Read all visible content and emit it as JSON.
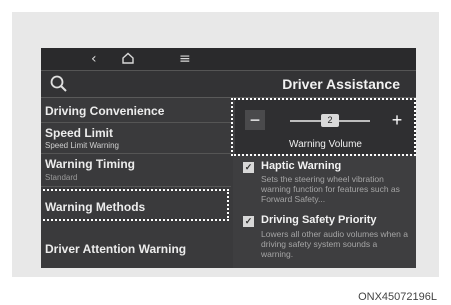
{
  "nav": {
    "back_icon": "chevron-left-icon",
    "home_icon": "home-icon",
    "menu_icon": "menu-icon"
  },
  "header": {
    "search_icon": "search-icon",
    "title": "Driver Assistance"
  },
  "menu": {
    "items": [
      {
        "label": "Driving Convenience",
        "sub": ""
      },
      {
        "label": "Speed Limit",
        "sub": "Speed Limit Warning"
      },
      {
        "label": "Warning Timing",
        "sub": "Standard"
      },
      {
        "label": "Warning Methods",
        "sub": "",
        "highlighted": true
      },
      {
        "label": "Driver Attention Warning",
        "sub": ""
      }
    ]
  },
  "volume": {
    "minus_label": "−",
    "plus_label": "+",
    "value": "2",
    "label": "Warning Volume"
  },
  "options": [
    {
      "title": "Haptic Warning",
      "desc": "Sets the steering wheel vibration warning function for features such as Forward Safety...",
      "checked": true
    },
    {
      "title": "Driving Safety Priority",
      "desc": "Lowers all other audio volumes when a driving safety system sounds a warning.",
      "checked": true
    }
  ],
  "caption": "ONX45072196L",
  "colors": {
    "screen_bg": "#3a3a3c",
    "highlight_outline": "#ffffff"
  }
}
